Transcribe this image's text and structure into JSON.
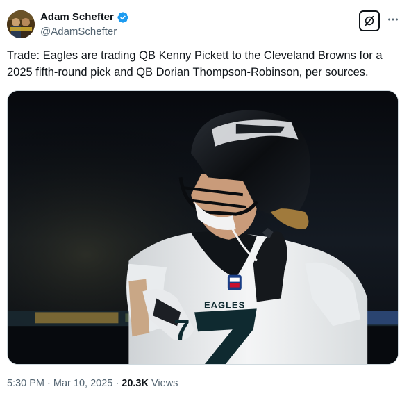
{
  "author": {
    "display_name": "Adam Schefter",
    "handle": "@AdamSchefter",
    "avatar_icon": "avatar-photo",
    "verified_color": "#1d9bf0"
  },
  "header_actions": {
    "grok_icon": "grok-slash-icon",
    "more_icon": "more-dots-icon"
  },
  "tweet": {
    "text": "Trade: Eagles are trading QB Kenny Pickett to the Cleveland Browns for a 2025 fifth-round pick and QB Dorian Thompson-Robinson, per sources.",
    "image": {
      "jersey_text": "EAGLES",
      "jersey_number": "7"
    }
  },
  "meta": {
    "time": "5:30 PM",
    "separator": "·",
    "date": "Mar 10, 2025",
    "views_count": "20.3K",
    "views_label": "Views"
  }
}
